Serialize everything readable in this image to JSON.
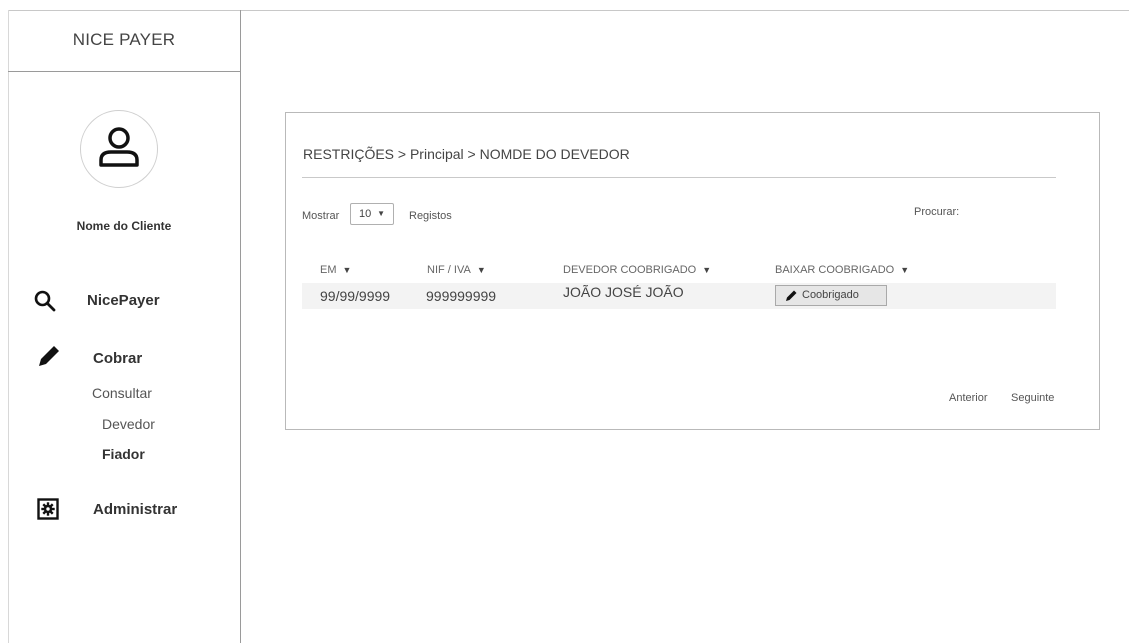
{
  "app": {
    "title": "NICE PAYER"
  },
  "user": {
    "name": "Nome do Cliente"
  },
  "sidebar": {
    "items": [
      {
        "label": "NicePayer",
        "icon": "search-icon"
      },
      {
        "label": "Cobrar",
        "icon": "pencil-icon"
      },
      {
        "label": "Administrar",
        "icon": "settings-icon"
      }
    ],
    "subitems": [
      {
        "label": "Consultar"
      },
      {
        "label": "Devedor"
      },
      {
        "label": "Fiador"
      }
    ]
  },
  "breadcrumb": "RESTRIÇÕES > Principal > NOMDE DO DEVEDOR",
  "table_controls": {
    "show_label": "Mostrar",
    "page_size": "10",
    "records_label": "Registos",
    "search_label": "Procurar:"
  },
  "table": {
    "headers": [
      "EM",
      "NIF / IVA",
      "DEVEDOR COOBRIGADO",
      "BAIXAR COOBRIGADO"
    ],
    "rows": [
      {
        "em": "99/99/9999",
        "nif": "999999999",
        "devedor": "JOÃO JOSÉ JOÃO",
        "action": "Coobrigado"
      }
    ]
  },
  "pagination": {
    "prev": "Anterior",
    "next": "Seguinte"
  }
}
